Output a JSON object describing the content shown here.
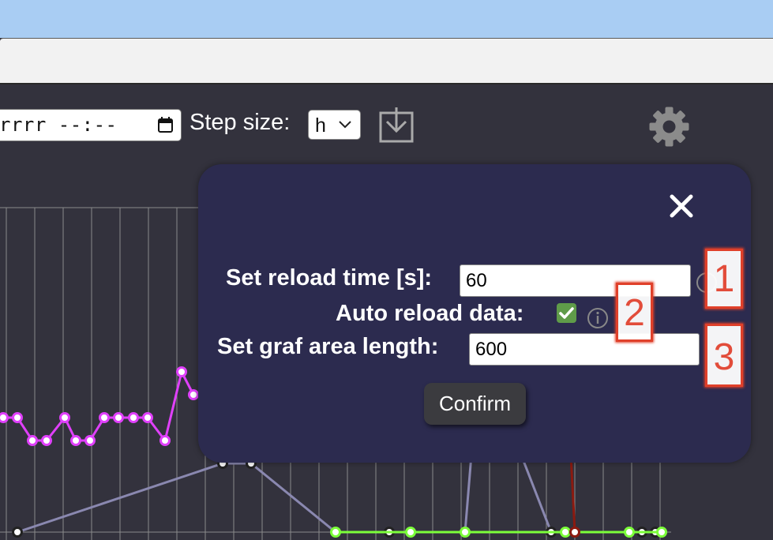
{
  "toolbar": {
    "date_value": "rrrr --:--",
    "step_label": "Step size:",
    "step_value": "h"
  },
  "modal": {
    "close_symbol": "✕",
    "reload_label": "Set reload time [s]:",
    "reload_value": "60",
    "auto_label": "Auto reload data:",
    "auto_checked": true,
    "graf_label": "Set graf area length:",
    "graf_value": "600",
    "confirm_label": "Confirm"
  },
  "annotations": [
    "1",
    "2",
    "3"
  ],
  "icons": [
    "calendar-icon",
    "chevron-down-icon",
    "download-icon",
    "gear-icon",
    "close-icon",
    "info-icon",
    "checkmark-icon"
  ],
  "colors": {
    "page_bg": "#33323d",
    "modal_bg": "#2c2b4f",
    "titlebar": "#a9cdf3",
    "series_magenta": "#e040fb",
    "series_slate": "#8a88b0",
    "series_green": "#7cff3a",
    "series_red": "#8b1a10",
    "checkbox": "#5f9b49",
    "marker": "#e0402a"
  },
  "chart_data": {
    "type": "line",
    "title": "",
    "xlabel": "",
    "ylabel": "",
    "grid": true,
    "series": [
      {
        "values": [
          6,
          6,
          5,
          5,
          6,
          5,
          5,
          6,
          6,
          6,
          6,
          5,
          8,
          7
        ]
      },
      {
        "values": [
          2,
          1,
          1,
          1,
          1,
          1,
          1,
          1,
          1,
          1,
          4,
          4,
          1,
          1,
          1,
          1,
          1,
          1,
          2,
          9,
          1,
          1,
          1,
          1,
          1,
          1
        ]
      },
      {
        "values": [
          1,
          1,
          1,
          1,
          1,
          1
        ]
      },
      {
        "values": [
          9,
          1
        ]
      }
    ]
  }
}
